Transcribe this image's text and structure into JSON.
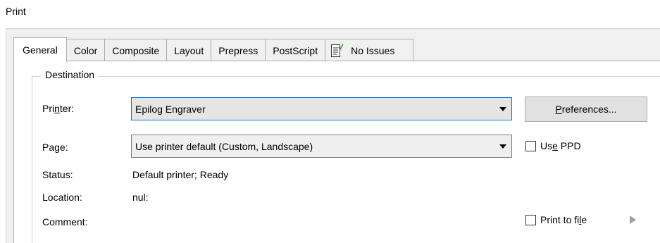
{
  "window": {
    "title": "Print"
  },
  "tabs": [
    {
      "label": "General",
      "active": true
    },
    {
      "label": "Color"
    },
    {
      "label": "Composite"
    },
    {
      "label": "Layout"
    },
    {
      "label": "Prepress"
    },
    {
      "label": "PostScript"
    },
    {
      "label": "No Issues",
      "icon": "issues-checklist-icon"
    }
  ],
  "destination": {
    "title": "Destination",
    "printer": {
      "label_pre": "Pri",
      "label_key": "n",
      "label_post": "ter:",
      "value": "Epilog Engraver"
    },
    "page": {
      "label_pre": "Pa",
      "label_key": "g",
      "label_post": "e:",
      "value": "Use printer default (Custom, Landscape)"
    },
    "status": {
      "label": "Status:",
      "value": "Default printer; Ready"
    },
    "location": {
      "label": "Location:",
      "value": "nul:"
    },
    "comment": {
      "label": "Comment:"
    },
    "preferences_button": {
      "key": "P",
      "rest": "references..."
    },
    "use_ppd": {
      "pre": "Us",
      "key": "e",
      "post": " PPD",
      "checked": false
    },
    "print_to_file": {
      "pre": "Print to fi",
      "key": "l",
      "post": "e",
      "checked": false
    }
  },
  "colors": {
    "focus_border": "#0078d7",
    "check_icon": "#2e9e2e"
  }
}
